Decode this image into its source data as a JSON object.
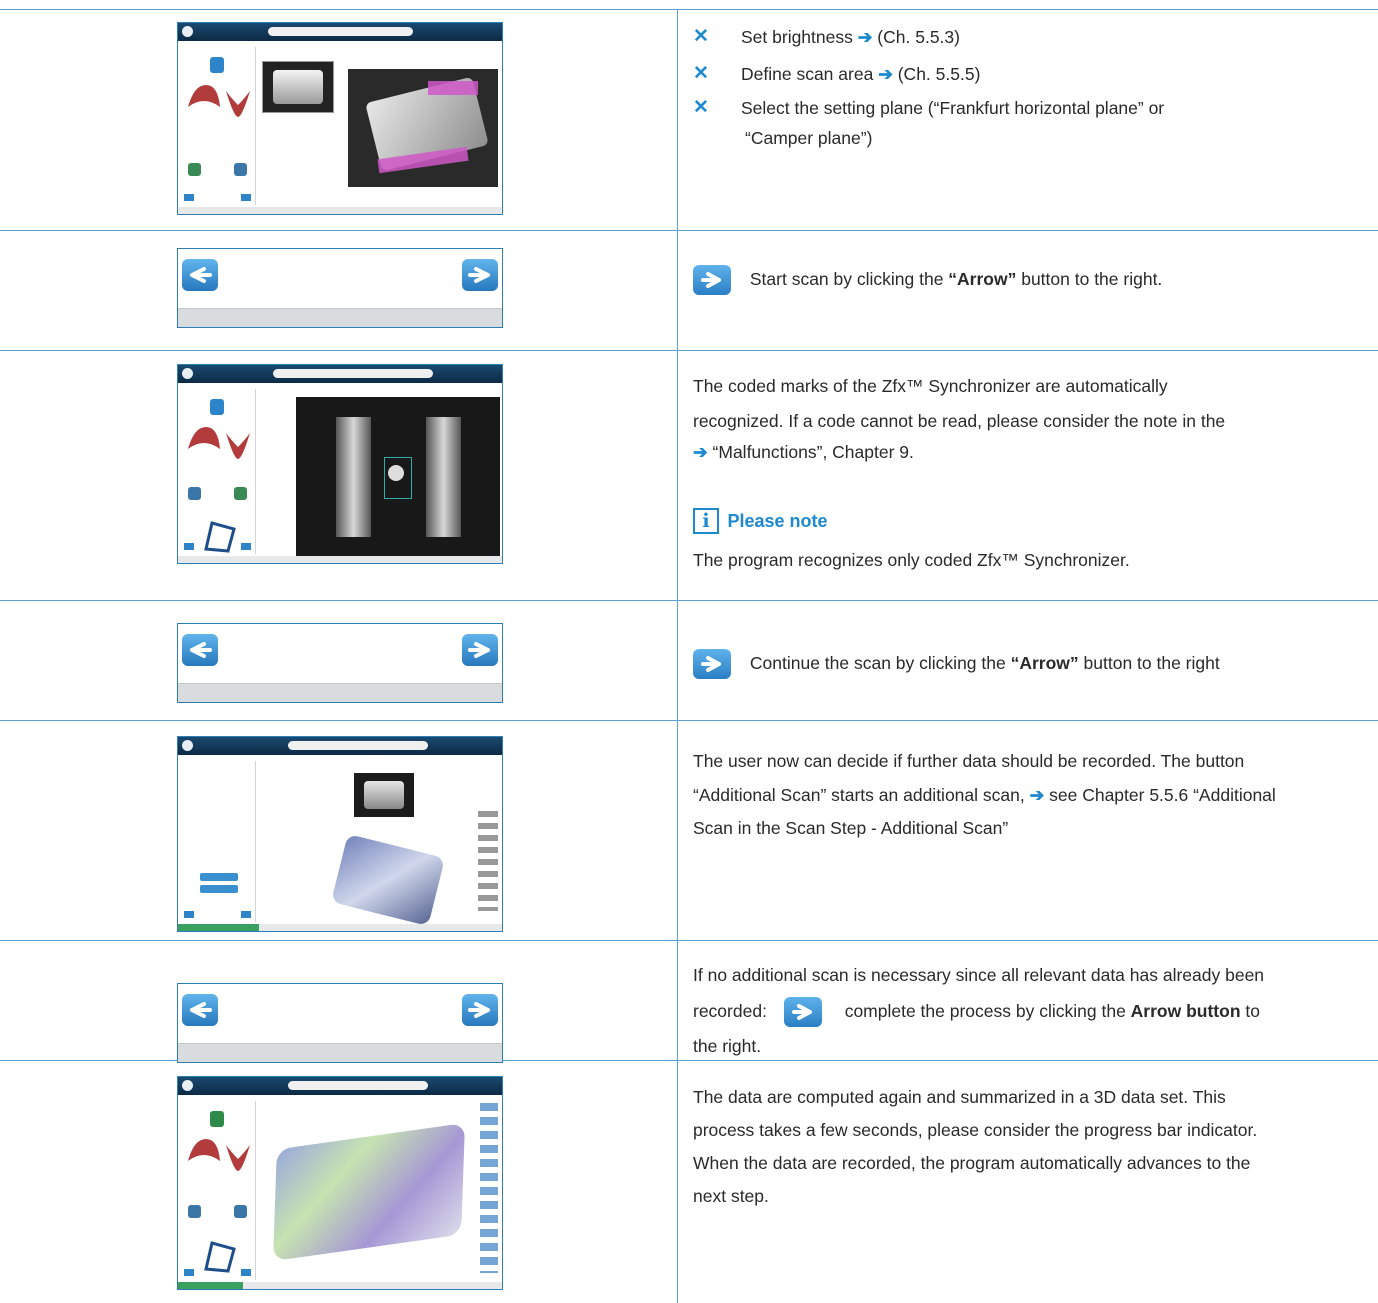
{
  "rows": [
    {
      "type": "screenshot",
      "items": [
        {
          "label": "Set brightness",
          "ref": "(Ch. 5.5.3)"
        },
        {
          "label": "Define scan area",
          "ref": "(Ch. 5.5.5)"
        },
        {
          "label": "Select the setting plane (“Frankfurt horizontal plane” or",
          "cont": "“Camper plane”)"
        }
      ]
    },
    {
      "type": "nav",
      "pre": "Start scan by clicking the ",
      "bold": "“Arrow”",
      "post": " button to the right."
    },
    {
      "type": "screenshot",
      "para_lines": [
        "The coded marks of the Zfx™ Synchronizer are automatically",
        "recognized. If a code cannot be read, please consider the note in the",
        "“Malfunctions”, Chapter 9."
      ],
      "note_icon": "i",
      "note_title": "Please note",
      "note_text": "The program recognizes only coded Zfx™ Synchronizer."
    },
    {
      "type": "nav",
      "pre": "Continue the scan by clicking the ",
      "bold": "“Arrow”",
      "post": " button to the right"
    },
    {
      "type": "screenshot",
      "para_lines": [
        "The user now can decide if further data should be recorded. The button",
        "“Additional Scan” starts an additional scan,",
        " see Chapter 5.5.6 “Additional",
        "Scan in the Scan Step - Additional Scan”"
      ]
    },
    {
      "type": "nav",
      "line1": "If no additional scan is necessary since all relevant data has already been",
      "line2_pre": "recorded:",
      "line2_mid": "complete the process by clicking the ",
      "bold": "Arrow button",
      "line2_post": " to",
      "line3": "the right."
    },
    {
      "type": "screenshot",
      "para_lines": [
        "The data are computed again and summarized in a 3D data set. This",
        "process takes a few seconds, please consider the progress bar indicator.",
        "When the data are recorded, the program automatically advances to the",
        "next step."
      ]
    }
  ],
  "colors": {
    "accent": "#1d8ad0",
    "rule": "#5aa0d0",
    "thumb_border": "#2c7fb8"
  }
}
